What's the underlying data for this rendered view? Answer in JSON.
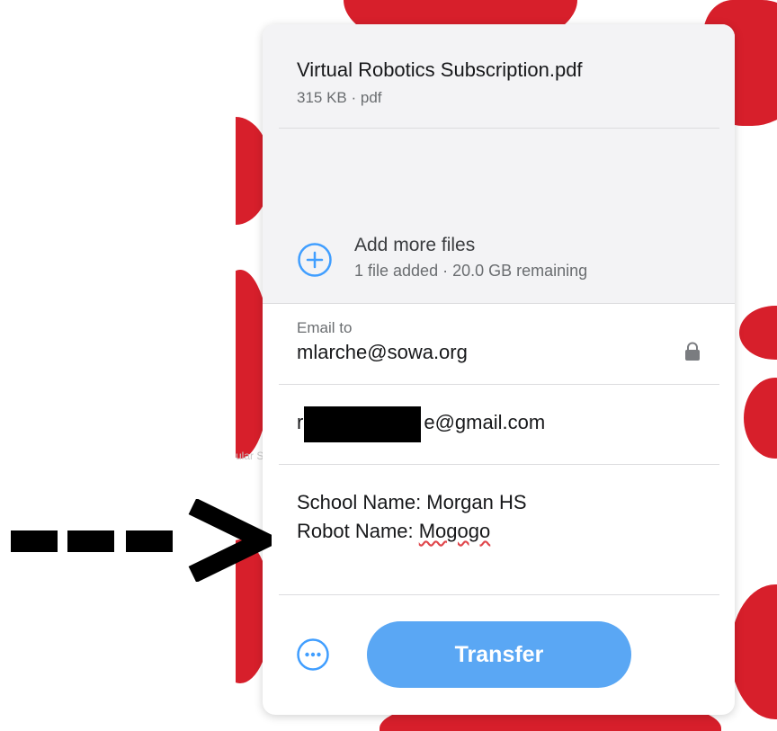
{
  "file": {
    "name": "Virtual Robotics Subscription.pdf",
    "meta": "315 KB · pdf"
  },
  "add_files": {
    "label": "Add more files",
    "status": "1 file added · 20.0 GB remaining",
    "icon": "plus-circle-icon"
  },
  "email_to": {
    "label": "Email to",
    "value": "mlarche@sowa.org",
    "icon": "lock-icon"
  },
  "your_email": {
    "value_prefix": "r",
    "value_suffix": "e@gmail.com"
  },
  "message": {
    "line1": "School Name: Morgan HS",
    "line2_prefix": "Robot Name: ",
    "line2_word": "Mogogo"
  },
  "actions": {
    "more_icon": "ellipsis-circle-icon",
    "transfer_label": "Transfer"
  },
  "background": {
    "faint_text": "ular Snip"
  },
  "colors": {
    "accent": "#5aa7f4",
    "icon_blue": "#409eff",
    "brand_red": "#d71f2b",
    "spellcheck": "#e0464b"
  }
}
